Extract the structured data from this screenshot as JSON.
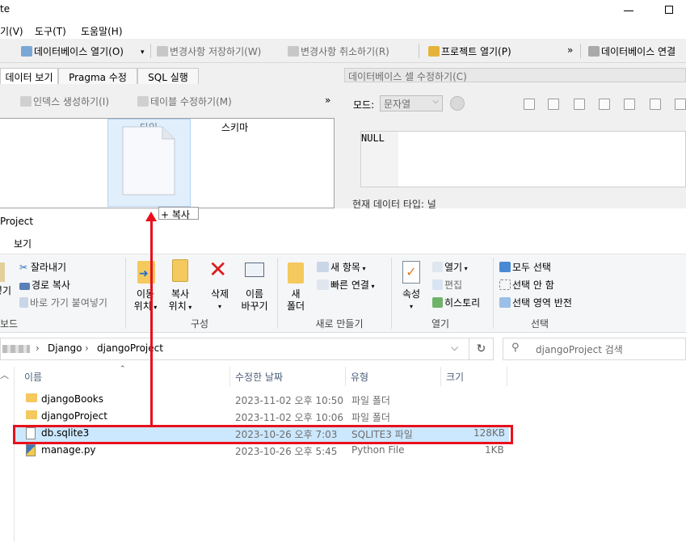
{
  "sqlite": {
    "title_fragment": "te",
    "menu": [
      "기(V)",
      "도구(T)",
      "도움말(H)"
    ],
    "toolbar": {
      "open_db": "데이터베이스 열기(O)",
      "save_changes": "변경사항 저장하기(W)",
      "revert_changes": "변경사항 취소하기(R)",
      "open_project": "프로젝트 열기(P)",
      "overflow": "»",
      "db_connect": "데이터베이스 연결"
    },
    "tabs": [
      "데이터 보기",
      "Pragma 수정",
      "SQL 실행"
    ],
    "subtoolbar": {
      "create_index": "인덱스 생성하기(I)",
      "modify_table": "테이블 수정하기(M)",
      "overflow": "»"
    },
    "columns": [
      "타입",
      "스키마"
    ],
    "edit_cell": {
      "title": "데이터베이스 셀 수정하기(C)",
      "mode_label": "모드:",
      "mode_value": "문자열",
      "value": "NULL",
      "type_label": "현재 데이터 타입: 널"
    },
    "drag_tip": "+ 복사"
  },
  "explorer": {
    "title": "Project",
    "ribbon_tab": "보기",
    "clipboard": {
      "cut": "잘라내기",
      "copy_path": "경로 복사",
      "paste_shortcut": "바로 가기 붙여넣기",
      "paste_partial": "넣기",
      "group": "보드"
    },
    "organize": {
      "move_to_1": "이동",
      "move_to_2": "위치",
      "copy_to_1": "복사",
      "copy_to_2": "위치",
      "delete": "삭제",
      "rename_1": "이름",
      "rename_2": "바꾸기",
      "group": "구성"
    },
    "new": {
      "new_folder_1": "새",
      "new_folder_2": "폴더",
      "new_item": "새 항목",
      "easy_access": "빠른 연결",
      "group": "새로 만들기"
    },
    "open": {
      "properties": "속성",
      "open": "열기",
      "edit": "편집",
      "history": "히스토리",
      "group": "열기"
    },
    "select": {
      "select_all": "모두 선택",
      "select_none": "선택 안 함",
      "invert": "선택 영역 반전",
      "group": "선택"
    },
    "address": {
      "crumbs": [
        "Django",
        "djangoProject"
      ],
      "search_placeholder": "djangoProject 검색"
    },
    "columns": [
      "이름",
      "수정한 날짜",
      "유형",
      "크기"
    ],
    "files": [
      {
        "name": "djangoBooks",
        "date": "2023-11-02 오후 10:50",
        "type": "파일 폴더",
        "size": ""
      },
      {
        "name": "djangoProject",
        "date": "2023-11-02 오후 10:06",
        "type": "파일 폴더",
        "size": ""
      },
      {
        "name": "db.sqlite3",
        "date": "2023-10-26 오후 7:03",
        "type": "SQLITE3 파일",
        "size": "128KB"
      },
      {
        "name": "manage.py",
        "date": "2023-10-26 오후 5:45",
        "type": "Python File",
        "size": "1KB"
      }
    ]
  },
  "colors": {
    "annotation_red": "#e8101c",
    "selection": "#cce8ff",
    "folder": "#f4c95d"
  }
}
